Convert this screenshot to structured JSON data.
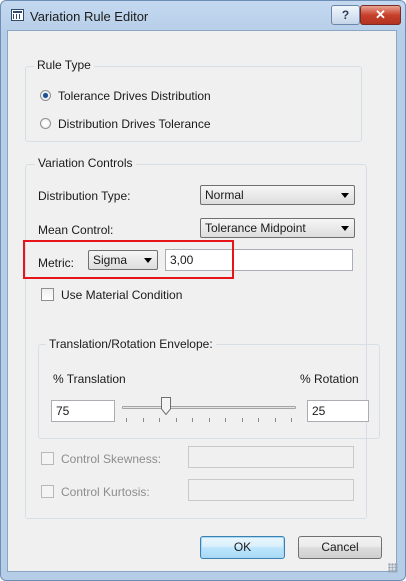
{
  "window": {
    "title": "Variation Rule Editor",
    "help_label": "?",
    "close_label": "✕"
  },
  "rule_type": {
    "title": "Rule Type",
    "options": [
      {
        "label": "Tolerance Drives Distribution",
        "checked": true
      },
      {
        "label": "Distribution Drives Tolerance",
        "checked": false
      }
    ]
  },
  "variation_controls": {
    "title": "Variation Controls",
    "distribution_type": {
      "label": "Distribution Type:",
      "value": "Normal"
    },
    "mean_control": {
      "label": "Mean Control:",
      "value": "Tolerance Midpoint"
    },
    "metric": {
      "label": "Metric:",
      "value": "Sigma",
      "input_value": "3,00"
    },
    "use_material_condition": {
      "label": "Use Material Condition",
      "checked": false
    }
  },
  "envelope": {
    "title": "Translation/Rotation Envelope:",
    "translation_label": "% Translation",
    "rotation_label": "% Rotation",
    "translation_value": "75",
    "rotation_value": "25",
    "slider_fraction": 0.25
  },
  "skewness": {
    "label": "Control Skewness:",
    "checked": false,
    "enabled": false,
    "value": ""
  },
  "kurtosis": {
    "label": "Control Kurtosis:",
    "checked": false,
    "enabled": false,
    "value": ""
  },
  "buttons": {
    "ok": "OK",
    "cancel": "Cancel"
  },
  "colors": {
    "highlight": "#e8141c",
    "title_bar": "#b6cde8",
    "default_button": "#3c7fb1"
  }
}
